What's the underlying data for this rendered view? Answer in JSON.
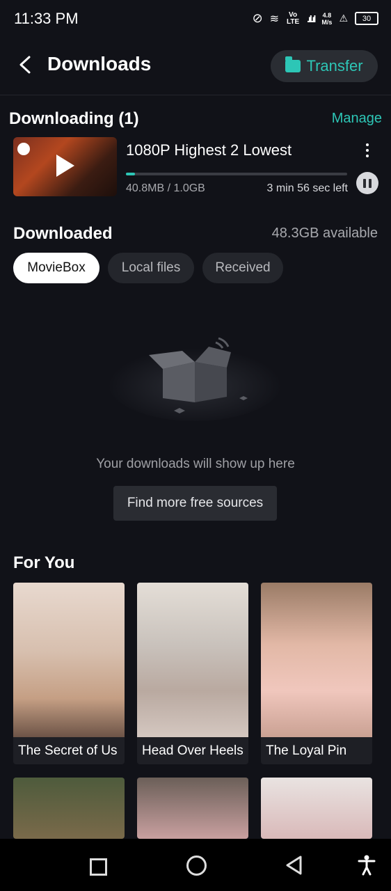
{
  "status_bar": {
    "time": "11:33 PM",
    "network_label": "Vo LTE",
    "speed": "4.8",
    "speed_unit": "M/s",
    "battery": "30"
  },
  "header": {
    "title": "Downloads",
    "transfer_label": "Transfer"
  },
  "downloading": {
    "title": "Downloading (1)",
    "manage_label": "Manage",
    "item": {
      "name": "1080P Highest 2 Lowest",
      "size": "40.8MB / 1.0GB",
      "eta": "3 min 56 sec left",
      "progress": 0.04
    }
  },
  "downloaded": {
    "title": "Downloaded",
    "available": "48.3GB available",
    "tabs": [
      {
        "label": "MovieBox",
        "active": true
      },
      {
        "label": "Local files",
        "active": false
      },
      {
        "label": "Received",
        "active": false
      }
    ],
    "empty_text": "Your downloads will show up here",
    "find_button": "Find more free sources"
  },
  "for_you": {
    "title": "For You",
    "items": [
      {
        "title": "The Secret of Us"
      },
      {
        "title": "Head Over Heels"
      },
      {
        "title": "The Loyal Pin"
      }
    ]
  },
  "colors": {
    "accent": "#2dc6b6",
    "background": "#111218"
  }
}
